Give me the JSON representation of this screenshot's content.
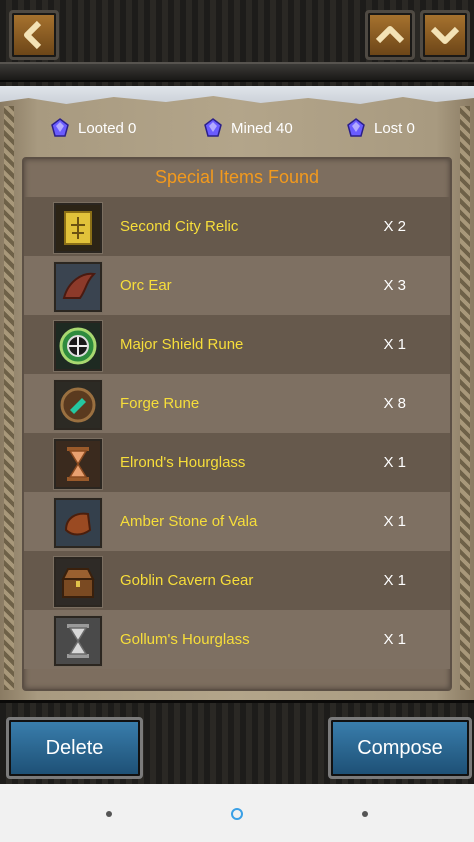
{
  "stats": [
    {
      "label": "Looted 0",
      "icon": "gem-icon"
    },
    {
      "label": "Mined 40",
      "icon": "gem-icon"
    },
    {
      "label": "Lost 0",
      "icon": "gem-icon"
    }
  ],
  "panel": {
    "title": "Special Items Found",
    "items": [
      {
        "name": "Second City Relic",
        "qty": "X 2",
        "icon": "relic-icon"
      },
      {
        "name": "Orc Ear",
        "qty": "X 3",
        "icon": "orc-ear-icon"
      },
      {
        "name": "Major Shield Rune",
        "qty": "X 1",
        "icon": "shield-rune-icon"
      },
      {
        "name": "Forge Rune",
        "qty": "X 8",
        "icon": "forge-rune-icon"
      },
      {
        "name": "Elrond's Hourglass",
        "qty": "X 1",
        "icon": "hourglass-icon"
      },
      {
        "name": "Amber Stone of Vala",
        "qty": "X 1",
        "icon": "amber-stone-icon"
      },
      {
        "name": "Goblin Cavern Gear",
        "qty": "X 1",
        "icon": "treasure-chest-icon"
      },
      {
        "name": "Gollum's Hourglass",
        "qty": "X 1",
        "icon": "hourglass-icon"
      }
    ]
  },
  "buttons": {
    "delete": "Delete",
    "compose": "Compose"
  },
  "colors": {
    "title": "#f39a1d",
    "item_name": "#f7de3a",
    "button_blue": "#2a6a97"
  }
}
